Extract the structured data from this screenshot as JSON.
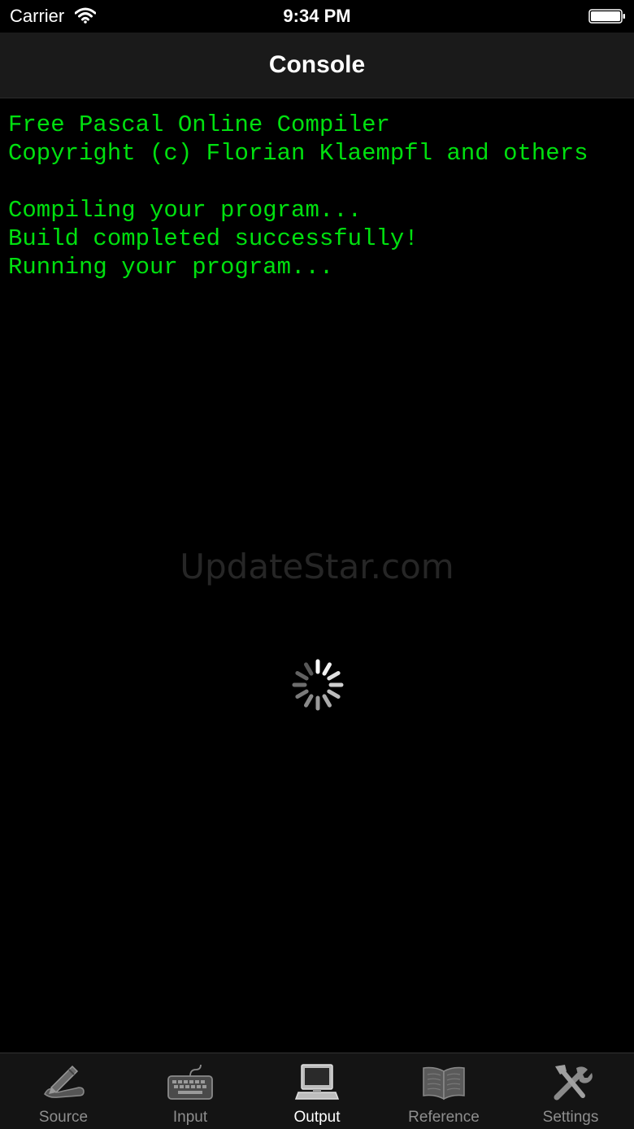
{
  "status_bar": {
    "carrier": "Carrier",
    "time": "9:34 PM"
  },
  "nav": {
    "title": "Console"
  },
  "console": {
    "lines": [
      "Free Pascal Online Compiler",
      "Copyright (c) Florian Klaempfl and others",
      "",
      "Compiling your program...",
      "Build completed successfully!",
      "Running your program..."
    ],
    "text_color": "#00e00f"
  },
  "watermark": "UpdateStar.com",
  "tabs": [
    {
      "label": "Source",
      "icon": "pencil-hand-icon",
      "active": false
    },
    {
      "label": "Input",
      "icon": "keyboard-icon",
      "active": false
    },
    {
      "label": "Output",
      "icon": "monitor-icon",
      "active": true
    },
    {
      "label": "Reference",
      "icon": "book-icon",
      "active": false
    },
    {
      "label": "Settings",
      "icon": "tools-icon",
      "active": false
    }
  ],
  "colors": {
    "background": "#000000",
    "nav_background": "#1a1a1a",
    "tab_active": "#ffffff",
    "tab_inactive": "#8e8e8e"
  }
}
